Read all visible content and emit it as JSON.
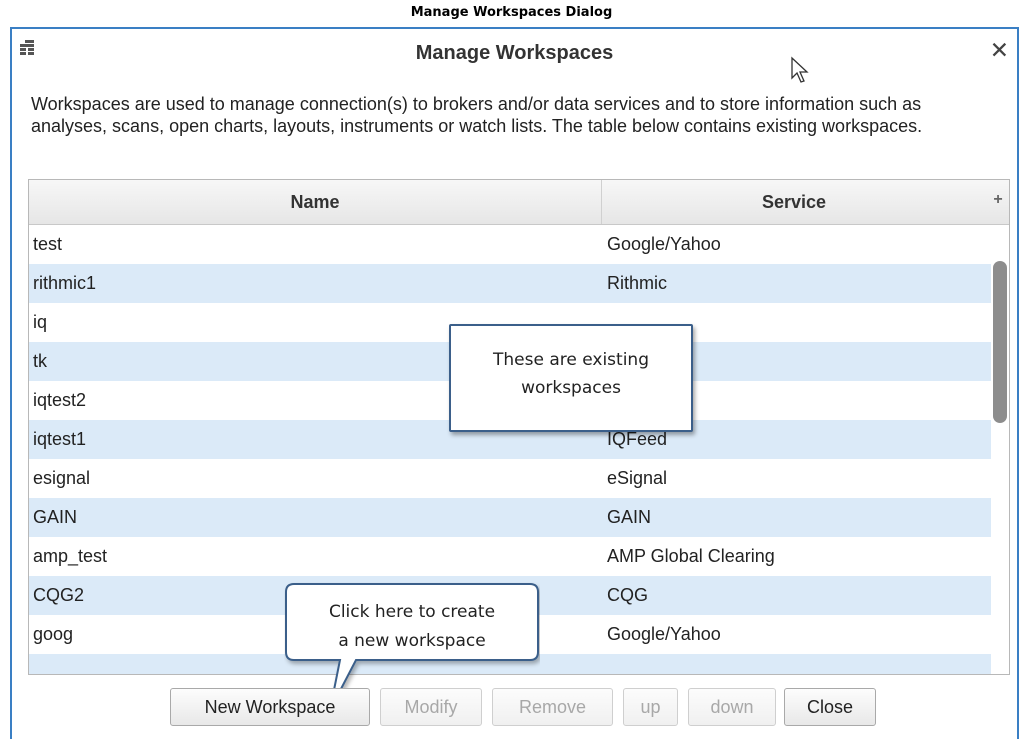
{
  "document": {
    "caption": "Manage Workspaces Dialog"
  },
  "dialog": {
    "title": "Manage Workspaces",
    "close_glyph": "✕",
    "description": "Workspaces are used to manage connection(s) to brokers and/or data services and to store information such as analyses, scans, open charts, layouts, instruments or watch lists. The table below contains existing workspaces."
  },
  "table": {
    "columns": {
      "name": "Name",
      "service": "Service",
      "add": "+"
    },
    "rows": [
      {
        "name": "test",
        "service": "Google/Yahoo"
      },
      {
        "name": "rithmic1",
        "service": "Rithmic"
      },
      {
        "name": "iq",
        "service": ""
      },
      {
        "name": "tk",
        "service": ""
      },
      {
        "name": "iqtest2",
        "service": ""
      },
      {
        "name": "iqtest1",
        "service": "IQFeed"
      },
      {
        "name": "esignal",
        "service": "eSignal"
      },
      {
        "name": "GAIN",
        "service": "GAIN"
      },
      {
        "name": "amp_test",
        "service": "AMP Global Clearing"
      },
      {
        "name": "CQG2",
        "service": "CQG"
      },
      {
        "name": "goog",
        "service": "Google/Yahoo"
      }
    ]
  },
  "callouts": {
    "existing": {
      "line1": "These are existing",
      "line2": "workspaces"
    },
    "new": {
      "line1": "Click here to create",
      "line2": "a new workspace"
    }
  },
  "buttons": {
    "new_workspace": "New Workspace",
    "modify": "Modify",
    "remove": "Remove",
    "up": "up",
    "down": "down",
    "close": "Close"
  },
  "icons": {
    "menu": "window-menu-icon",
    "close": "close-icon",
    "cursor": "mouse-pointer-icon"
  },
  "colors": {
    "accent_border": "#3a7fc4",
    "row_alt": "#dbeaf8",
    "callout_border": "#3b5f8a"
  }
}
